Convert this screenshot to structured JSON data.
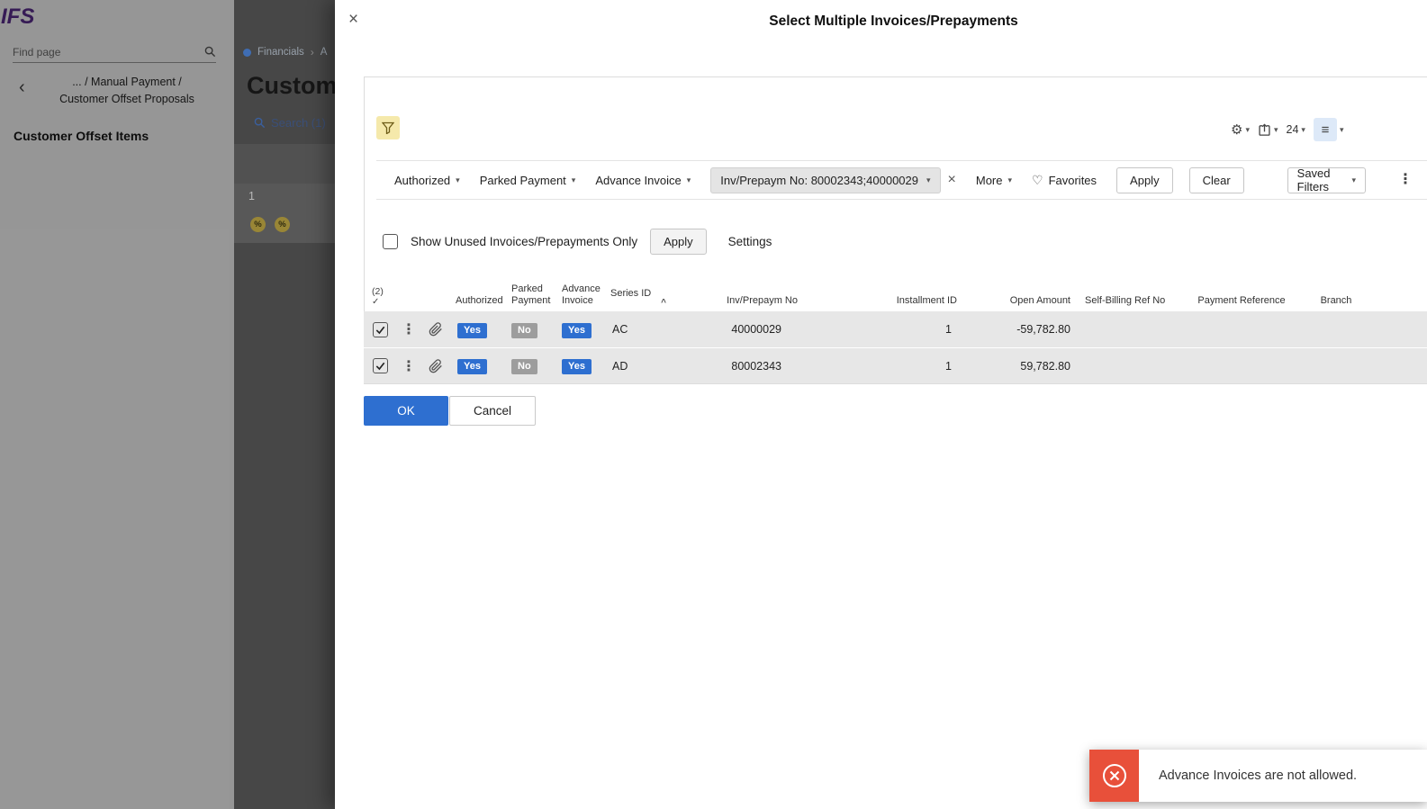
{
  "brand": {
    "logo_text": "IFS"
  },
  "sidebar": {
    "find_page": "Find page",
    "nav_line1": "... / Manual Payment /",
    "nav_line2": "Customer Offset Proposals",
    "section_title": "Customer Offset Items"
  },
  "background": {
    "crumb_financials": "Financials",
    "crumb_next": "A",
    "page_title_partial": "Custom",
    "search_link": "Search (1)",
    "row_index": "1",
    "percent_badge": "%"
  },
  "dialog": {
    "title": "Select Multiple Invoices/Prepayments",
    "toolbar": {
      "page_size": "24"
    },
    "filterbar": {
      "authorized": "Authorized",
      "parked_payment": "Parked Payment",
      "advance_invoice": "Advance Invoice",
      "active_chip": "Inv/Prepaym No: 80002343;40000029",
      "more": "More",
      "favorites": "Favorites",
      "apply": "Apply",
      "clear": "Clear",
      "saved_filters": "Saved Filters"
    },
    "options": {
      "show_unused_label": "Show Unused Invoices/Prepayments Only",
      "apply": "Apply",
      "settings": "Settings"
    },
    "table": {
      "selection_count": "(2)",
      "columns": [
        "Authorized",
        "Parked Payment",
        "Advance Invoice",
        "Series ID",
        "Inv/Prepaym No",
        "Installment ID",
        "Open Amount",
        "Self-Billing Ref No",
        "Payment Reference",
        "Branch"
      ],
      "rows": [
        {
          "authorized": "Yes",
          "parked_payment": "No",
          "advance_invoice": "Yes",
          "series_id": "AC",
          "inv_prepaym_no": "40000029",
          "installment_id": "1",
          "open_amount": "-59,782.80",
          "self_billing_ref_no": "",
          "payment_reference": "",
          "branch": ""
        },
        {
          "authorized": "Yes",
          "parked_payment": "No",
          "advance_invoice": "Yes",
          "series_id": "AD",
          "inv_prepaym_no": "80002343",
          "installment_id": "1",
          "open_amount": "59,782.80",
          "self_billing_ref_no": "",
          "payment_reference": "",
          "branch": ""
        }
      ]
    },
    "actions": {
      "ok": "OK",
      "cancel": "Cancel"
    }
  },
  "toast": {
    "message": "Advance Invoices are not allowed."
  },
  "icons": {
    "close": "×",
    "caret_down": "▾",
    "kebab": "⋮",
    "heart": "♡",
    "gear": "⚙",
    "list_view": "≡",
    "sort_asc": "^",
    "check": "✓",
    "chevron_left": "‹",
    "crumb_sep": "›",
    "chip_close": "×"
  },
  "colors": {
    "accent_blue": "#2e6fd0",
    "badge_gray": "#9d9d9d",
    "error_red": "#e8503a",
    "brand_purple": "#5b2d8e",
    "filter_active_yellow": "#f5e9ab"
  }
}
